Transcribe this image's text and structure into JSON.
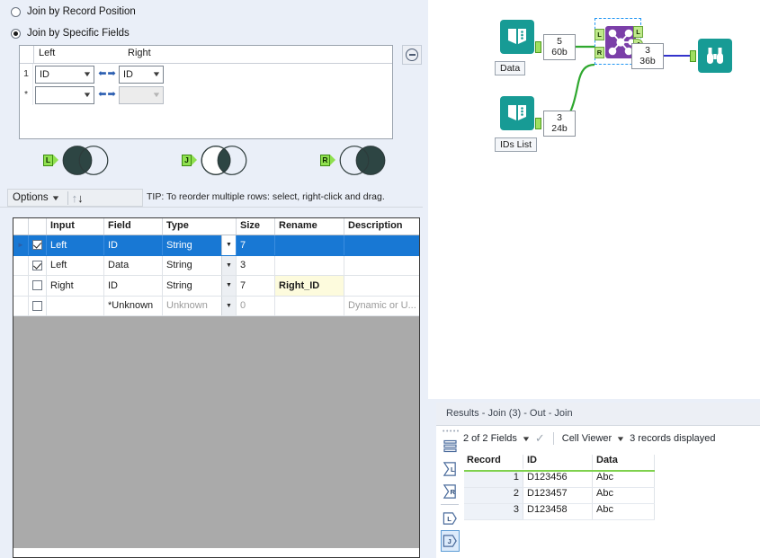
{
  "config": {
    "join_modes": [
      {
        "label": "Join by Record Position",
        "selected": false
      },
      {
        "label": "Join by Specific Fields",
        "selected": true
      }
    ],
    "join_fields": {
      "headers": {
        "left": "Left",
        "right": "Right"
      },
      "rows": [
        {
          "num": "1",
          "left": "ID",
          "right": "ID",
          "right_disabled": false
        },
        {
          "num": "*",
          "left": "",
          "right": "",
          "right_disabled": true
        }
      ]
    },
    "remove_button_icon": "minus-circle-icon",
    "venn_outputs": [
      {
        "tag": "L",
        "name": "left-unjoined-output",
        "fill": "left"
      },
      {
        "tag": "J",
        "name": "join-output",
        "fill": "intersection"
      },
      {
        "tag": "R",
        "name": "right-unjoined-output",
        "fill": "right"
      }
    ],
    "options_label": "Options",
    "sort_up_icon": "arrow-up-icon",
    "sort_down_icon": "arrow-down-icon",
    "tip": "TIP: To reorder multiple rows: select, right-click and drag.",
    "field_grid": {
      "headers": [
        "",
        "",
        "Input",
        "Field",
        "Type",
        "Size",
        "Rename",
        "Description"
      ],
      "rows": [
        {
          "selected": true,
          "checked": true,
          "input": "Left",
          "field": "ID",
          "type": "String",
          "type_disabled": false,
          "size": "7",
          "rename": "",
          "rename_highlight": false,
          "description": "",
          "description_muted": false
        },
        {
          "selected": false,
          "checked": true,
          "input": "Left",
          "field": "Data",
          "type": "String",
          "type_disabled": false,
          "size": "3",
          "rename": "",
          "rename_highlight": false,
          "description": "",
          "description_muted": false
        },
        {
          "selected": false,
          "checked": false,
          "input": "Right",
          "field": "ID",
          "type": "String",
          "type_disabled": false,
          "size": "7",
          "rename": "Right_ID",
          "rename_highlight": true,
          "description": "",
          "description_muted": false
        },
        {
          "selected": false,
          "checked": false,
          "input": "",
          "field": "*Unknown",
          "type": "Unknown",
          "type_disabled": true,
          "size": "0",
          "rename": "",
          "rename_highlight": false,
          "description": "Dynamic or U...",
          "description_muted": true
        }
      ]
    }
  },
  "canvas": {
    "nodes": [
      {
        "name": "input-data",
        "icon": "input-data-icon",
        "label": "Data"
      },
      {
        "name": "input-ids-list",
        "icon": "input-data-icon",
        "label": "IDs List"
      },
      {
        "name": "join-tool",
        "icon": "join-tool-icon",
        "label": "",
        "selected": true
      },
      {
        "name": "browse-tool",
        "icon": "binoculars-icon",
        "label": ""
      }
    ],
    "counters": [
      {
        "name": "data-record-count",
        "records": "5",
        "size": "60b"
      },
      {
        "name": "ids-record-count",
        "records": "3",
        "size": "24b"
      },
      {
        "name": "join-output-count",
        "records": "3",
        "size": "36b"
      }
    ],
    "join_anchors": {
      "in": [
        "L",
        "R"
      ],
      "out": [
        "L",
        "J",
        "R"
      ]
    }
  },
  "results": {
    "tab_title": "Results - Join (3) - Out - Join",
    "sidebar_buttons": [
      {
        "name": "all-records-button",
        "icon": "list-icon",
        "label": ""
      },
      {
        "name": "left-summary-button",
        "icon": "sigma-l-icon",
        "label": "L"
      },
      {
        "name": "right-summary-button",
        "icon": "sigma-r-icon",
        "label": "R"
      },
      {
        "name": "left-output-button",
        "icon": "anchor-l-icon",
        "label": "L"
      },
      {
        "name": "join-output-button",
        "icon": "anchor-j-icon",
        "label": "J",
        "active": true
      }
    ],
    "toolbar": {
      "fields_label": "2 of 2 Fields",
      "check_icon": "checkmark-icon",
      "cell_viewer_label": "Cell Viewer",
      "records_label": "3 records displayed"
    },
    "grid": {
      "headers": [
        "Record",
        "ID",
        "Data"
      ],
      "rows": [
        {
          "record": "1",
          "id": "D123456",
          "data": "Abc"
        },
        {
          "record": "2",
          "id": "D123457",
          "data": "Abc"
        },
        {
          "record": "3",
          "id": "D123458",
          "data": "Abc"
        }
      ]
    }
  },
  "colors": {
    "accent_blue": "#1878d4",
    "panel_bg": "#eaeff8",
    "node_teal": "#179b95",
    "join_purple": "#7b3fa8",
    "anchor_green": "#9fdf60",
    "highlight_yellow": "#fdfbdd"
  }
}
